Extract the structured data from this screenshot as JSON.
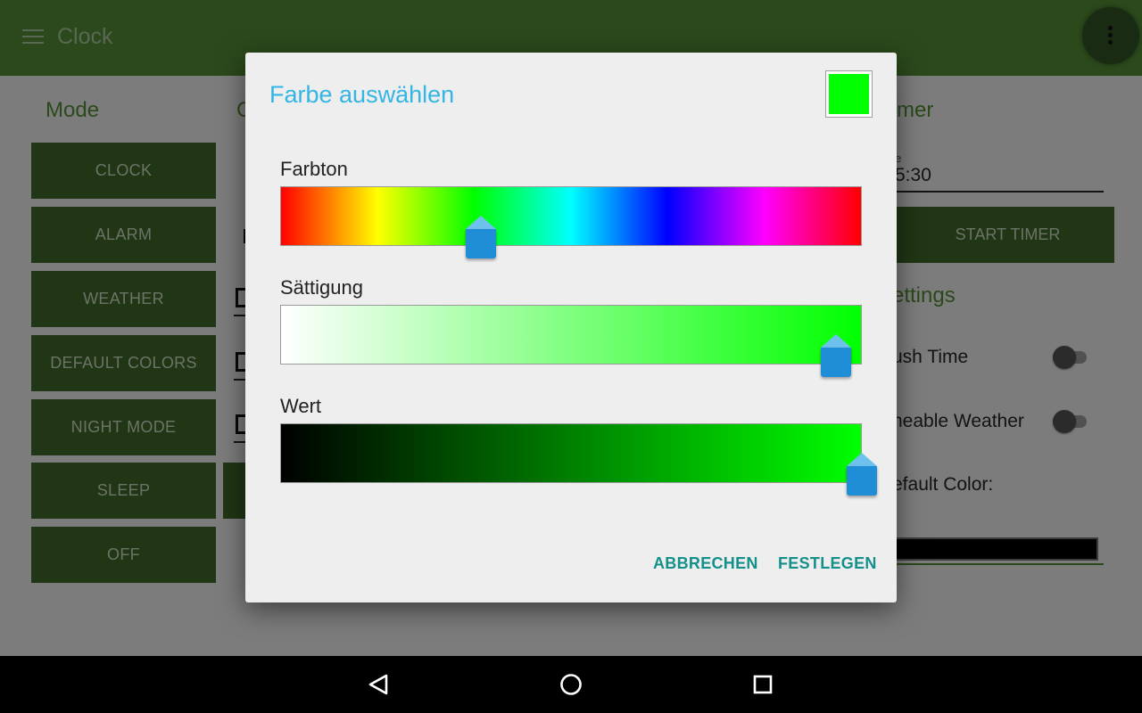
{
  "app": {
    "title": "Clock",
    "mode_title": "Mode",
    "mode_buttons": [
      "CLOCK",
      "ALARM",
      "WEATHER",
      "DEFAULT COLORS",
      "NIGHT MODE",
      "SLEEP",
      "OFF"
    ],
    "timer": {
      "title_fragment": "mer",
      "hint_fragment": "e",
      "value_fragment": "5:30",
      "start_label": "START TIMER"
    },
    "settings": {
      "title_fragment": "ettings",
      "items": [
        {
          "label_fragment": "ush Time",
          "toggle_on": false
        },
        {
          "label_fragment": "neable Weather",
          "toggle_on": false
        }
      ],
      "default_color_fragment": "efault Color:",
      "default_color_value": "#000000"
    }
  },
  "dialog": {
    "title": "Farbe auswählen",
    "preview_color": "#00ff00",
    "sliders": [
      {
        "label": "Farbton",
        "value": 0.345,
        "kind": "hue"
      },
      {
        "label": "Sättigung",
        "value": 0.955,
        "kind": "saturation"
      },
      {
        "label": "Wert",
        "value": 1.0,
        "kind": "value"
      }
    ],
    "cancel_label": "ABBRECHEN",
    "confirm_label": "FESTLEGEN"
  },
  "colors": {
    "accent_title": "#33b5e5",
    "button_text": "#14908a",
    "app_green": "#4a7e2f",
    "handle_blue": "#1f8ed6"
  },
  "nav": {
    "icons": [
      "back-icon",
      "home-icon",
      "recents-icon"
    ]
  }
}
